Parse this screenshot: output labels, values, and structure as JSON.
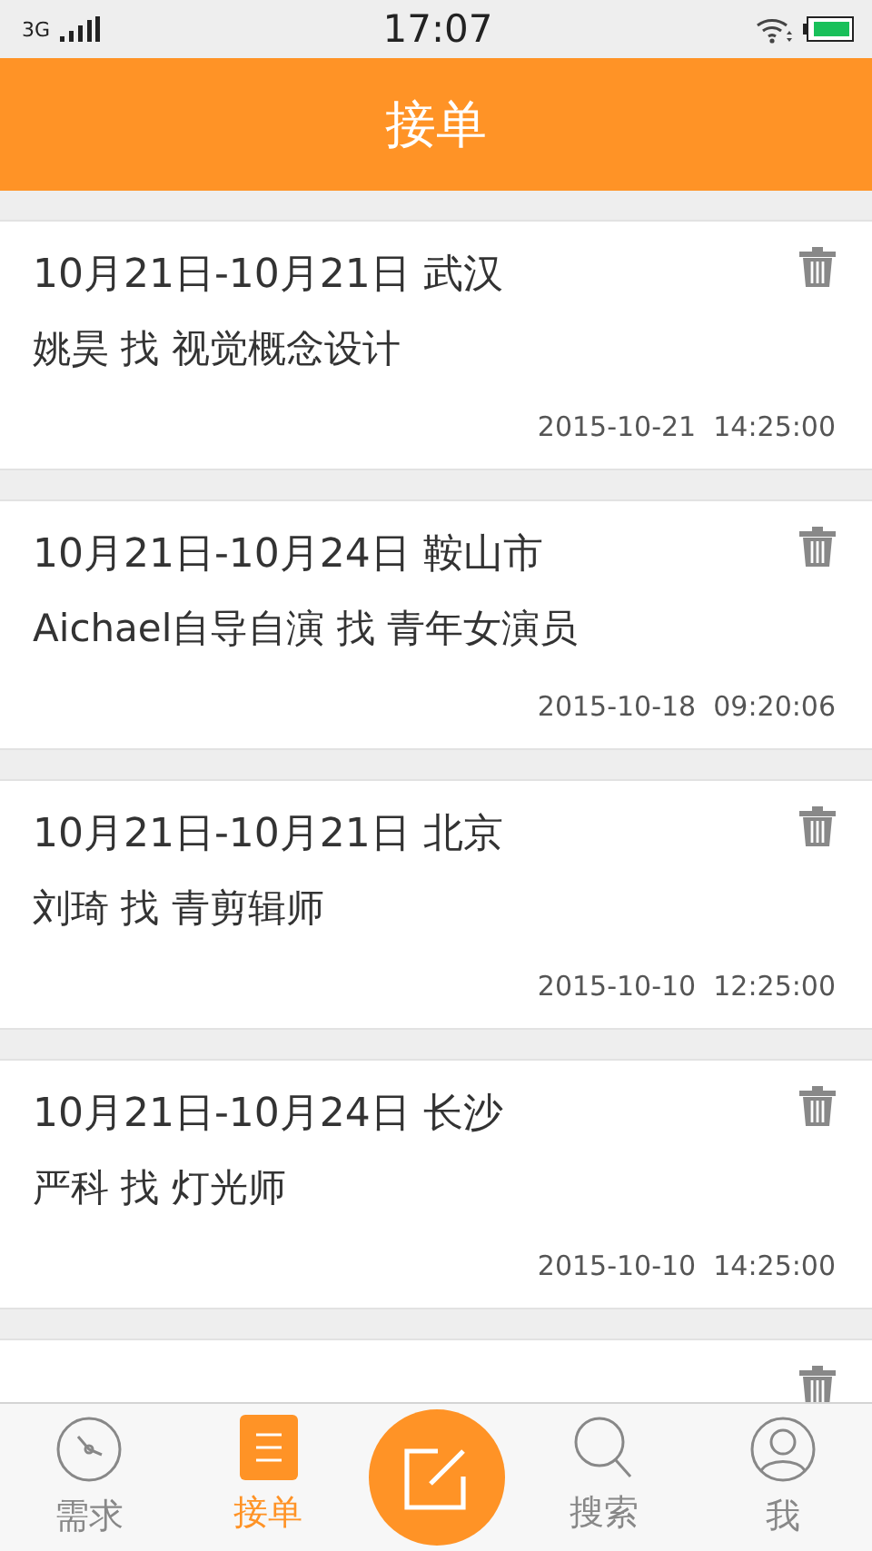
{
  "status_bar": {
    "network": "3G",
    "time": "17:07"
  },
  "header": {
    "title": "接单"
  },
  "orders": [
    {
      "dates": "10月21日-10月21日 武汉",
      "request": "姚昊 找 视觉概念设计",
      "posted": "2015-10-21  14:25:00"
    },
    {
      "dates": "10月21日-10月24日 鞍山市",
      "request": "Aichael自导自演 找 青年女演员",
      "posted": "2015-10-18  09:20:06"
    },
    {
      "dates": "10月21日-10月21日 北京",
      "request": "刘琦 找 青剪辑师",
      "posted": "2015-10-10  12:25:00"
    },
    {
      "dates": "10月21日-10月24日 长沙",
      "request": "严科 找 灯光师",
      "posted": "2015-10-10  14:25:00"
    }
  ],
  "more_below": true,
  "tab_bar": [
    {
      "kind": "compass",
      "label": "需求",
      "selected": false
    },
    {
      "kind": "list",
      "label": "接单",
      "selected": true
    },
    {
      "kind": "compose",
      "selected": false
    },
    {
      "kind": "search",
      "label": "搜索",
      "selected": false
    },
    {
      "kind": "profile",
      "label": "我",
      "selected": false
    }
  ]
}
